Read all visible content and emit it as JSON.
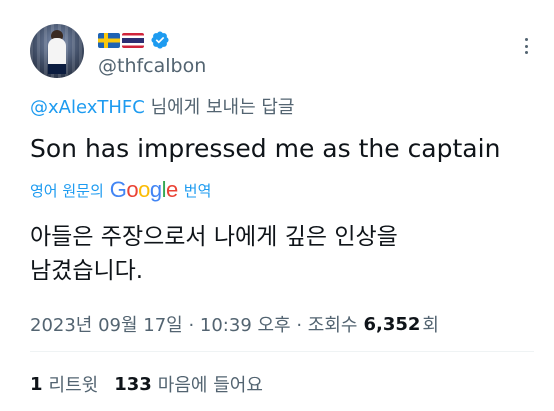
{
  "author": {
    "handle": "@thfcalbon",
    "flags": [
      "sweden-flag",
      "thailand-flag"
    ],
    "verified": true
  },
  "reply": {
    "mention": "@xAlexTHFC",
    "suffix": " 님에게 보내는 답글"
  },
  "tweet": {
    "text": "Son has impressed me as the captain"
  },
  "translation": {
    "prefix": "영어 원문의",
    "google_letters": [
      "G",
      "o",
      "o",
      "g",
      "l",
      "e"
    ],
    "google_colors": [
      "#4285F4",
      "#EA4335",
      "#FBBC05",
      "#4285F4",
      "#34A853",
      "#EA4335"
    ],
    "suffix": "번역",
    "text_line1": "아들은 주장으로서 나에게 깊은 인상을",
    "text_line2": "남겼습니다."
  },
  "meta": {
    "timestamp": "2023년 09월 17일 · 10:39 오후 · 조회수",
    "views": "6,352",
    "views_unit": "회"
  },
  "stats": {
    "retweets_count": "1",
    "retweets_label": "리트윗",
    "likes_count": "133",
    "likes_label": "마음에 들어요"
  },
  "colors": {
    "accent": "#1d9bf0",
    "secondary_text": "#536471",
    "primary_text": "#0f1419"
  }
}
